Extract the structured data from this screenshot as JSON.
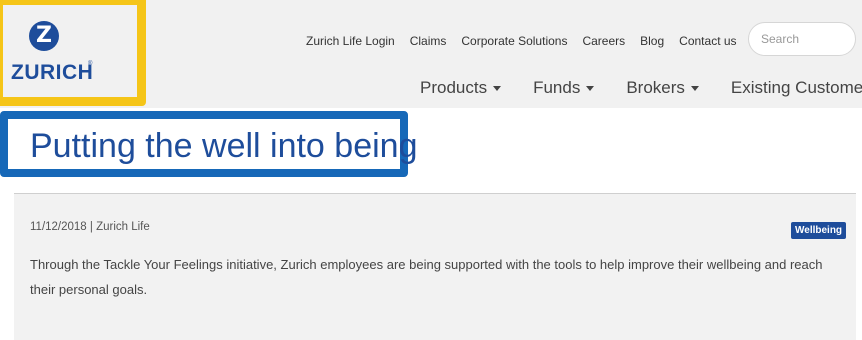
{
  "header": {
    "logo": {
      "mark": "Z",
      "wordmark": "ZURICH",
      "reg": "®"
    },
    "top_links": [
      "Zurich Life Login",
      "Claims",
      "Corporate Solutions",
      "Careers",
      "Blog",
      "Contact us"
    ],
    "search": {
      "placeholder": "Search",
      "value": ""
    },
    "main_nav": [
      "Products",
      "Funds",
      "Brokers",
      "Existing Customers"
    ]
  },
  "page": {
    "title": "Putting the well into being"
  },
  "article": {
    "meta": "11/12/2018 | Zurich Life",
    "tag": "Wellbeing",
    "summary": "Through the Tackle Your Feelings initiative, Zurich employees are being supported with the tools to help improve their wellbeing and reach their personal goals."
  },
  "colors": {
    "brand_blue": "#1e4d9b",
    "highlight_yellow": "#f5c518",
    "highlight_blue": "#1668b8"
  }
}
